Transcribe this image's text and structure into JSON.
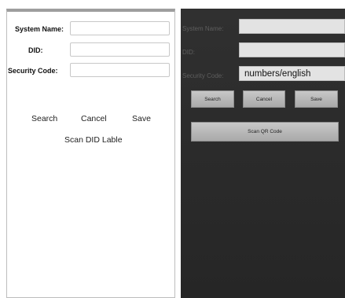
{
  "left": {
    "labels": {
      "system_name": "System Name:",
      "did": "DID:",
      "security_code": "Security Code:"
    },
    "fields": {
      "system_name": "",
      "did": "",
      "security_code": ""
    },
    "buttons": {
      "search": "Search",
      "cancel": "Cancel",
      "save": "Save",
      "scan": "Scan DID Lable"
    }
  },
  "right": {
    "labels": {
      "system_name": "System Name:",
      "did": "DID:",
      "security_code": "Security Code:"
    },
    "fields": {
      "system_name": "",
      "did": "",
      "security_code": "numbers/english"
    },
    "buttons": {
      "search": "Search",
      "cancel": "Cancel",
      "save": "Save",
      "scan": "Scan QR Code"
    }
  },
  "colors": {
    "dark_background": "#2b2b2b",
    "button_gray": "#b5b5b5",
    "field_gray": "#e3e3e3"
  }
}
